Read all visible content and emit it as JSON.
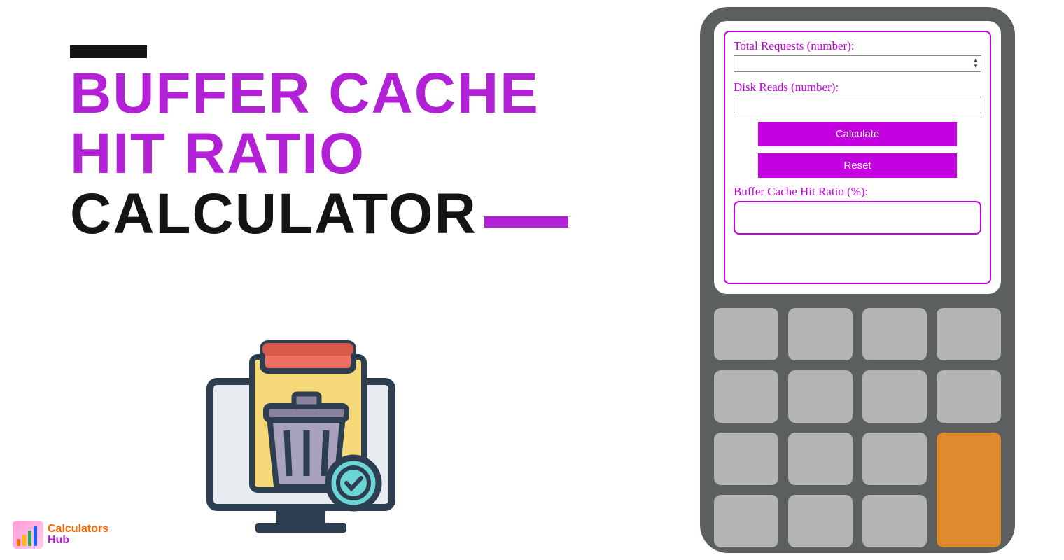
{
  "title": {
    "line1": "Buffer Cache",
    "line2": "Hit Ratio",
    "line3": "Calculator"
  },
  "form": {
    "total_requests_label": "Total Requests (number):",
    "total_requests_value": "",
    "disk_reads_label": "Disk Reads (number):",
    "disk_reads_value": "",
    "calculate_label": "Calculate",
    "reset_label": "Reset",
    "result_label": "Buffer Cache Hit Ratio (%):",
    "result_value": ""
  },
  "logo": {
    "top": "Calculators",
    "bottom": "Hub"
  },
  "icons": {
    "trash": "trash-icon",
    "monitor": "monitor-icon",
    "window": "window-icon",
    "check": "check-badge-icon",
    "spinner": "number-spinner-icon"
  }
}
